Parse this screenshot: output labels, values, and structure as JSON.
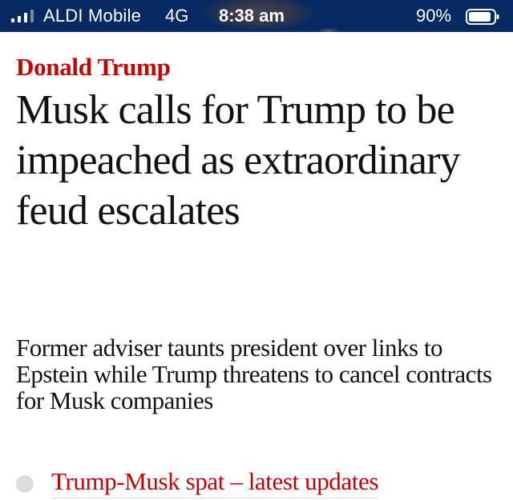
{
  "status_bar": {
    "carrier": "ALDI Mobile",
    "network": "4G",
    "time": "8:38 am",
    "battery_percent": "90%",
    "battery_level": 0.9,
    "signal_icon": "cellular-signal-icon",
    "battery_icon": "battery-icon"
  },
  "article": {
    "kicker": "Donald Trump",
    "headline": "Musk calls for Trump to be impeached as extraordinary feud escalates",
    "standfirst": "Former adviser taunts president over links to Epstein while Trump threatens to cancel contracts for Musk companies",
    "related_link": "Trump-Musk spat – latest updates",
    "related_icon": "live-dot-icon"
  },
  "colors": {
    "status_bar_bg": "#052962",
    "kicker": "#c70000",
    "text": "#121212",
    "live_dot": "#dcdcdc"
  }
}
